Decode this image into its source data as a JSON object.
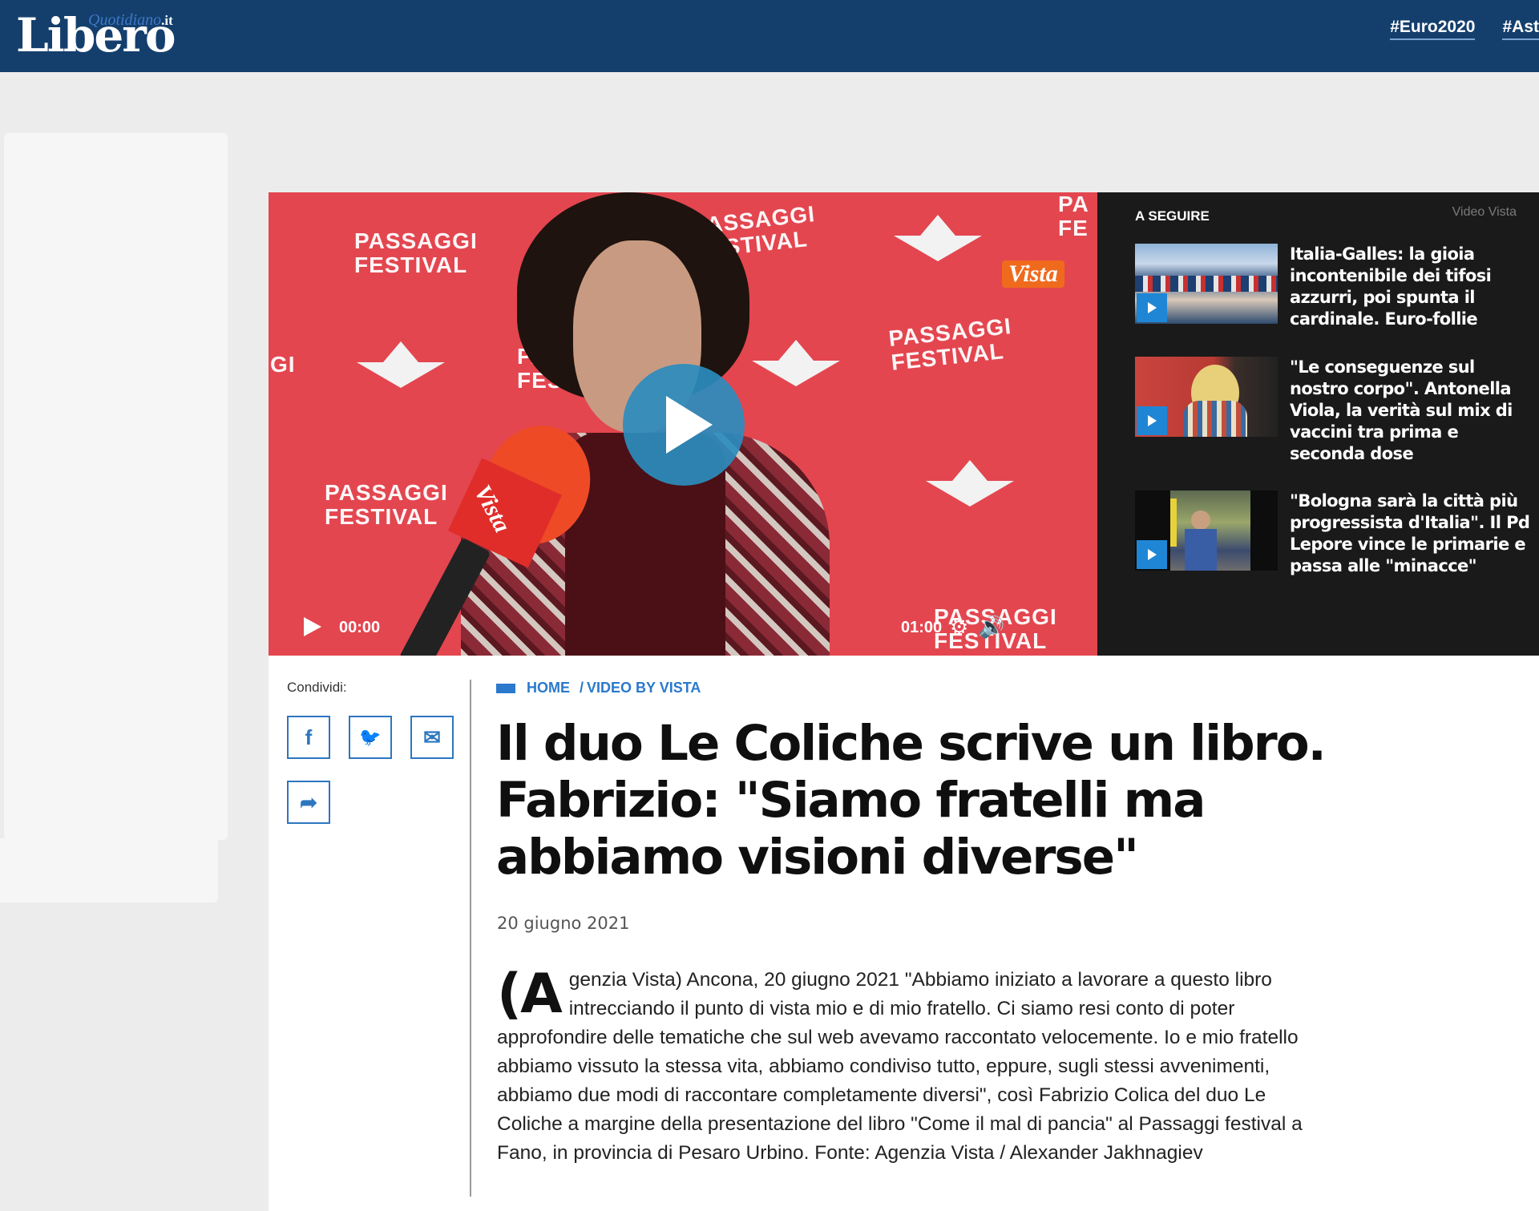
{
  "header": {
    "logo_main": "Libero",
    "logo_sub": "Quotidiano",
    "logo_tld": ".it",
    "tags": [
      "#Euro2020",
      "#Ast"
    ]
  },
  "video": {
    "wall_text": [
      "PASSAGGI\nFESTIVAL",
      "PASSAGGI\nFESTIVAL",
      "PASSAGGI\nFESTIVAL",
      "PASSAGGI\nFESTIVAL",
      "PA\nFES",
      "PA\nFE",
      "GI",
      "PASSAGGI\nFESTIVAL"
    ],
    "brand": "Vista",
    "mic_brand": "Vista",
    "time_current": "00:00",
    "time_total": "01:00",
    "icons": {
      "play": "play-icon",
      "settings": "gear-icon",
      "volume": "volume-icon"
    }
  },
  "up_next": {
    "title": "A SEGUIRE",
    "source": "Video Vista",
    "items": [
      {
        "title": "Italia-Galles: la gioia incontenibile dei tifosi azzurri, poi spunta il cardinale. Euro-follie"
      },
      {
        "title": "\"Le conseguenze sul nostro corpo\". Antonella Viola, la verità sul mix di vaccini tra prima e seconda dose"
      },
      {
        "title": "\"Bologna sarà la città più progressista d'Italia\". Il Pd Lepore vince le primarie e passa alle \"minacce\""
      }
    ]
  },
  "share": {
    "label": "Condividi:",
    "buttons": [
      {
        "name": "facebook",
        "glyph": "f"
      },
      {
        "name": "twitter",
        "glyph": "🐦"
      },
      {
        "name": "email",
        "glyph": "✉"
      },
      {
        "name": "share",
        "glyph": "➦"
      }
    ]
  },
  "article": {
    "breadcrumb": [
      "HOME",
      "VIDEO BY VISTA"
    ],
    "breadcrumb_sep": "/",
    "headline": "Il duo Le Coliche scrive un libro. Fabrizio: \"Siamo fratelli ma abbiamo visioni diverse\"",
    "date": "20 giugno 2021",
    "dropcap": "(A",
    "body": "genzia Vista) Ancona, 20 giugno 2021 \"Abbiamo iniziato a lavorare a questo libro intrecciando il punto di vista mio e di mio fratello. Ci siamo resi conto di poter approfondire delle tematiche che sul web avevamo raccontato velocemente. Io e mio fratello abbiamo vissuto la stessa vita, abbiamo condiviso tutto, eppure, sugli stessi avvenimenti, abbiamo due modi di raccontare completamente diversi\", così Fabrizio Colica del duo Le Coliche a margine della presentazione del libro \"Come il mal di pancia\" al Passaggi festival a Fano, in provincia di Pesaro Urbino. Fonte: Agenzia Vista / Alexander Jakhnagiev"
  },
  "colors": {
    "header_bg": "#143f6d",
    "accent": "#2a79cc",
    "video_bg": "#e3464f",
    "sidebar_bg": "#1a1a1a"
  }
}
